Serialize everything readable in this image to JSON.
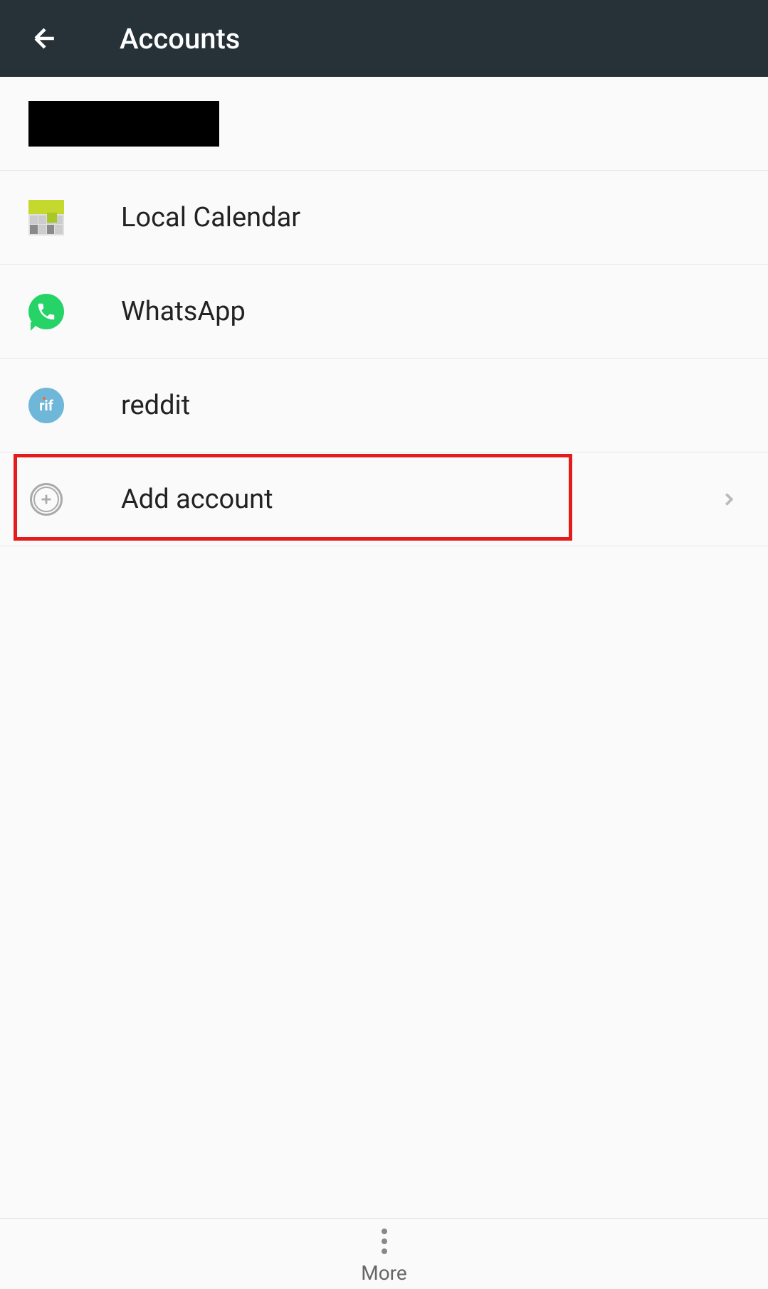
{
  "header": {
    "title": "Accounts"
  },
  "accounts": [
    {
      "icon": "calendar-icon",
      "label": "Local Calendar"
    },
    {
      "icon": "whatsapp-icon",
      "label": "WhatsApp"
    },
    {
      "icon": "rif-icon",
      "icon_text": "rif",
      "label": "reddit"
    }
  ],
  "add_account": {
    "label": "Add account"
  },
  "bottom": {
    "more_label": "More"
  }
}
